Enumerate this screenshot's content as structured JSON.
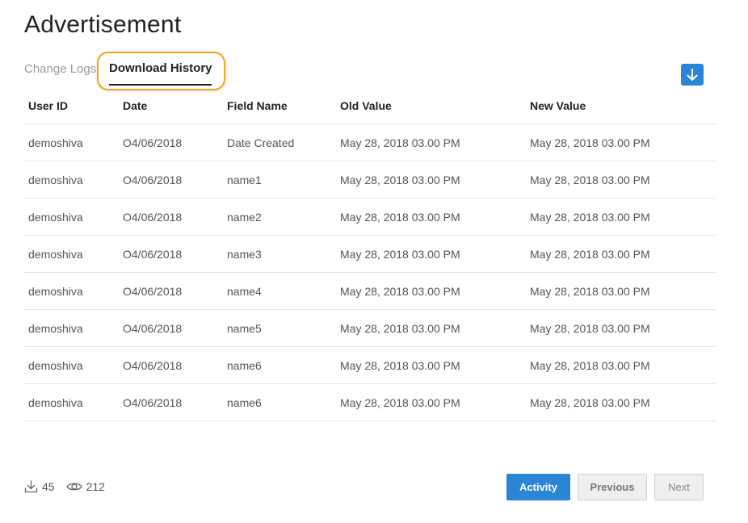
{
  "page": {
    "title": "Advertisement"
  },
  "tabs": {
    "change_logs": "Change Logs",
    "download_history": "Download History"
  },
  "table": {
    "headers": [
      "User ID",
      "Date",
      "Field Name",
      "Old Value",
      "New Value"
    ],
    "rows": [
      [
        "demoshiva",
        "O4/06/2018",
        "Date Created",
        "May 28, 2018 03.00 PM",
        "May 28, 2018 03.00 PM"
      ],
      [
        "demoshiva",
        "O4/06/2018",
        "name1",
        "May 28, 2018 03.00 PM",
        "May 28, 2018 03.00 PM"
      ],
      [
        "demoshiva",
        "O4/06/2018",
        "name2",
        "May 28, 2018 03.00 PM",
        "May 28, 2018 03.00 PM"
      ],
      [
        "demoshiva",
        "O4/06/2018",
        "name3",
        "May 28, 2018 03.00 PM",
        "May 28, 2018 03.00 PM"
      ],
      [
        "demoshiva",
        "O4/06/2018",
        "name4",
        "May 28, 2018 03.00 PM",
        "May 28, 2018 03.00 PM"
      ],
      [
        "demoshiva",
        "O4/06/2018",
        "name5",
        "May 28, 2018 03.00 PM",
        "May 28, 2018 03.00 PM"
      ],
      [
        "demoshiva",
        "O4/06/2018",
        "name6",
        "May 28, 2018 03.00 PM",
        "May 28, 2018 03.00 PM"
      ],
      [
        "demoshiva",
        "O4/06/2018",
        "name6",
        "May 28, 2018 03.00 PM",
        "May 28, 2018 03.00 PM"
      ]
    ]
  },
  "stats": {
    "downloads": "45",
    "views": "212",
    "download_icon": "download-icon",
    "views_icon": "eye-icon"
  },
  "buttons": {
    "activity": "Activity",
    "previous": "Previous",
    "next": "Next"
  },
  "colors": {
    "accent": "#2a85d6",
    "highlight": "#f0a818"
  }
}
